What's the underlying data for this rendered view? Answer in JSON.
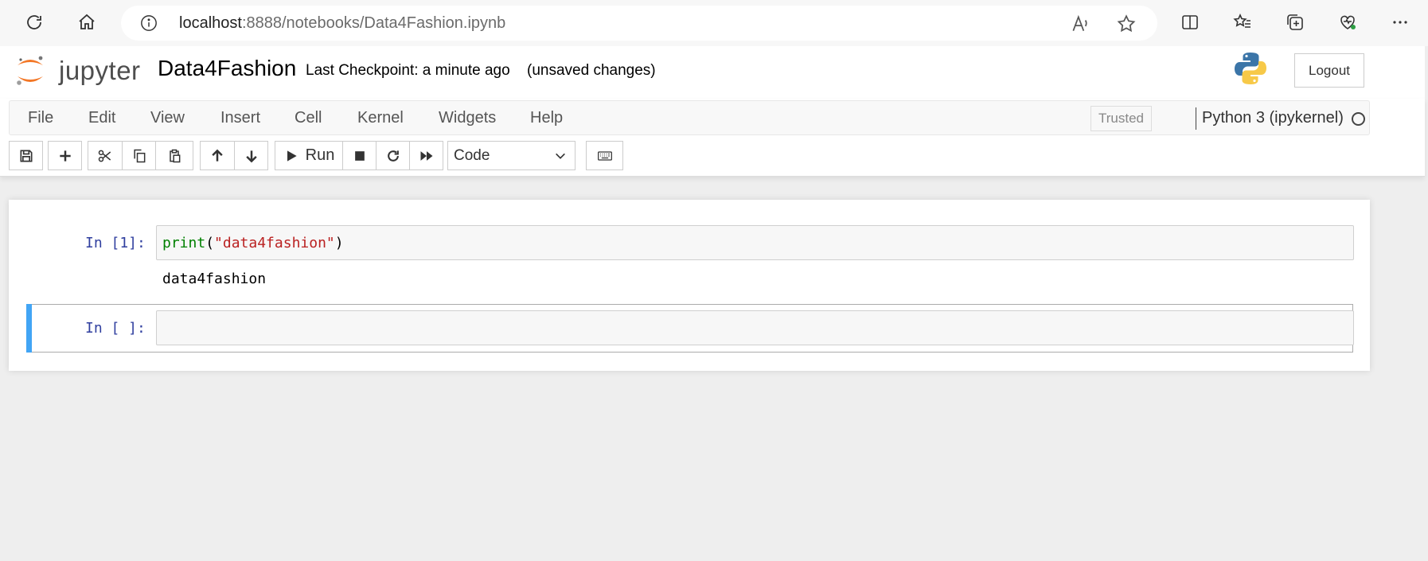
{
  "browser": {
    "url_host": "localhost",
    "url_path": ":8888/notebooks/Data4Fashion.ipynb"
  },
  "header": {
    "logo_text": "jupyter",
    "notebook_name": "Data4Fashion",
    "checkpoint": "Last Checkpoint: a minute ago",
    "unsaved": "(unsaved changes)",
    "logout_label": "Logout"
  },
  "menubar": {
    "items": [
      "File",
      "Edit",
      "View",
      "Insert",
      "Cell",
      "Kernel",
      "Widgets",
      "Help"
    ],
    "trusted": "Trusted",
    "kernel": "Python 3 (ipykernel)"
  },
  "toolbar": {
    "run_label": "Run",
    "cell_type": "Code"
  },
  "cells": [
    {
      "prompt": "In [1]:",
      "code_fn": "print",
      "code_open": "(",
      "code_str": "\"data4fashion\"",
      "code_close": ")",
      "output": "data4fashion"
    },
    {
      "prompt": "In [ ]:",
      "code": ""
    }
  ],
  "colors": {
    "accent": "#42a5f5",
    "prompt": "#303f9f",
    "keyword": "#008000",
    "string": "#ba2121",
    "jupyter_orange": "#f37726"
  }
}
